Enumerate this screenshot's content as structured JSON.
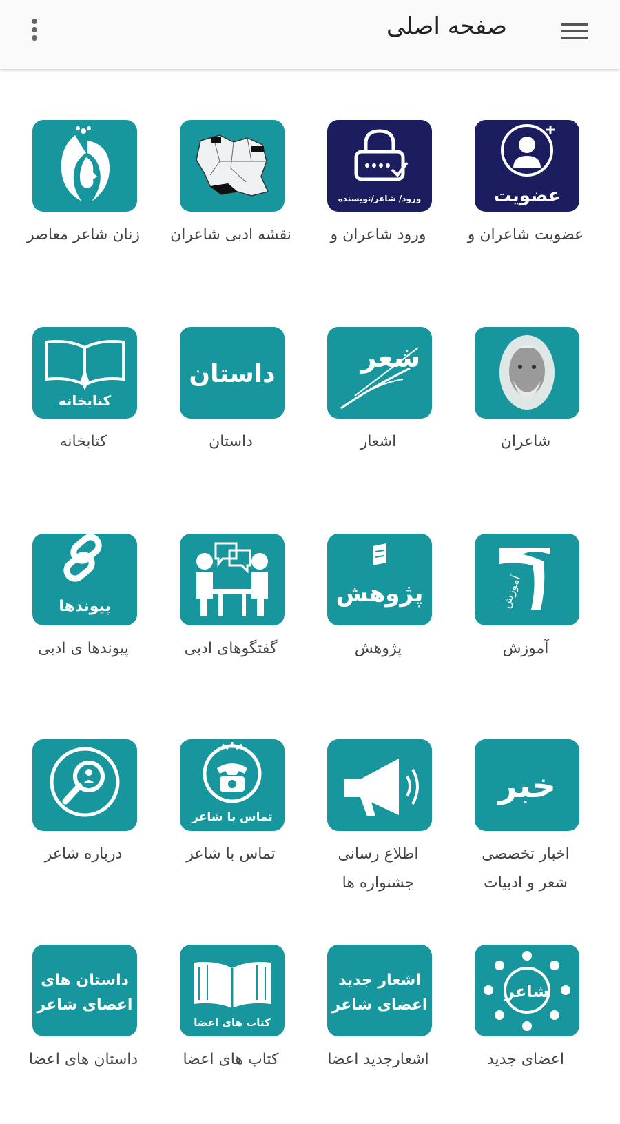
{
  "app_bar": {
    "title": "صفحه اصلی",
    "menu_icon": "hamburger-menu-icon",
    "overflow_icon": "more-vert-icon"
  },
  "colors": {
    "tile_teal": "#17979d",
    "tile_navy": "#1b1d5e",
    "app_bar_bg": "#fafafa"
  },
  "tiles": [
    {
      "label": "عضویت شاعران و",
      "icon": "membership-icon",
      "icon_text": "عضویت"
    },
    {
      "label": "ورود شاعران و",
      "icon": "login-lock-icon",
      "icon_text": "ورود/ شاعر/نویسنده"
    },
    {
      "label": "نقشه ادبی شاعران",
      "icon": "iran-map-icon"
    },
    {
      "label": "زنان شاعر معاصر",
      "icon": "woman-profile-icon"
    },
    {
      "label": "شاعران",
      "icon": "poet-portrait-icon"
    },
    {
      "label": "اشعار",
      "icon": "poetry-calligraphy-icon",
      "icon_text": "شعر"
    },
    {
      "label": "داستان",
      "icon": "story-calligraphy-icon",
      "icon_text": "داستان"
    },
    {
      "label": "کتابخانه",
      "icon": "open-book-icon",
      "icon_text": "کتابخانه"
    },
    {
      "label": "آموزش",
      "icon": "education-icon",
      "icon_text": "آموزش"
    },
    {
      "label": "پژوهش",
      "icon": "research-icon",
      "icon_text": "پژوهش"
    },
    {
      "label": "گفتگوهای ادبی",
      "icon": "conversation-icon"
    },
    {
      "label": "پیوندها ی ادبی",
      "icon": "link-icon",
      "icon_text": "پیوندها"
    },
    {
      "label": "اخبار تخصصی",
      "label2": "شعر و ادبیات",
      "icon": "news-icon",
      "icon_text": "خبر"
    },
    {
      "label": "اطلاع رسانی",
      "label2": "جشنواره ها",
      "icon": "megaphone-icon"
    },
    {
      "label": "تماس با شاعر",
      "icon": "telephone-icon",
      "icon_text": "تماس با شاعر"
    },
    {
      "label": "درباره شاعر",
      "icon": "about-search-icon"
    },
    {
      "label": "اعضای جدید",
      "icon": "members-circle-icon",
      "icon_text": "شاعر"
    },
    {
      "label": "اشعارجدید اعضا",
      "icon": "new-poems-icon",
      "icon_text": "اشعار جدید",
      "icon_text2": "اعضای شاعر"
    },
    {
      "label": "کتاب های اعضا",
      "icon": "members-books-icon",
      "icon_text": "کتاب های اعضا"
    },
    {
      "label": "داستان های اعضا",
      "icon": "members-stories-icon",
      "icon_text": "داستان های",
      "icon_text2": "اعضای شاعر"
    }
  ]
}
